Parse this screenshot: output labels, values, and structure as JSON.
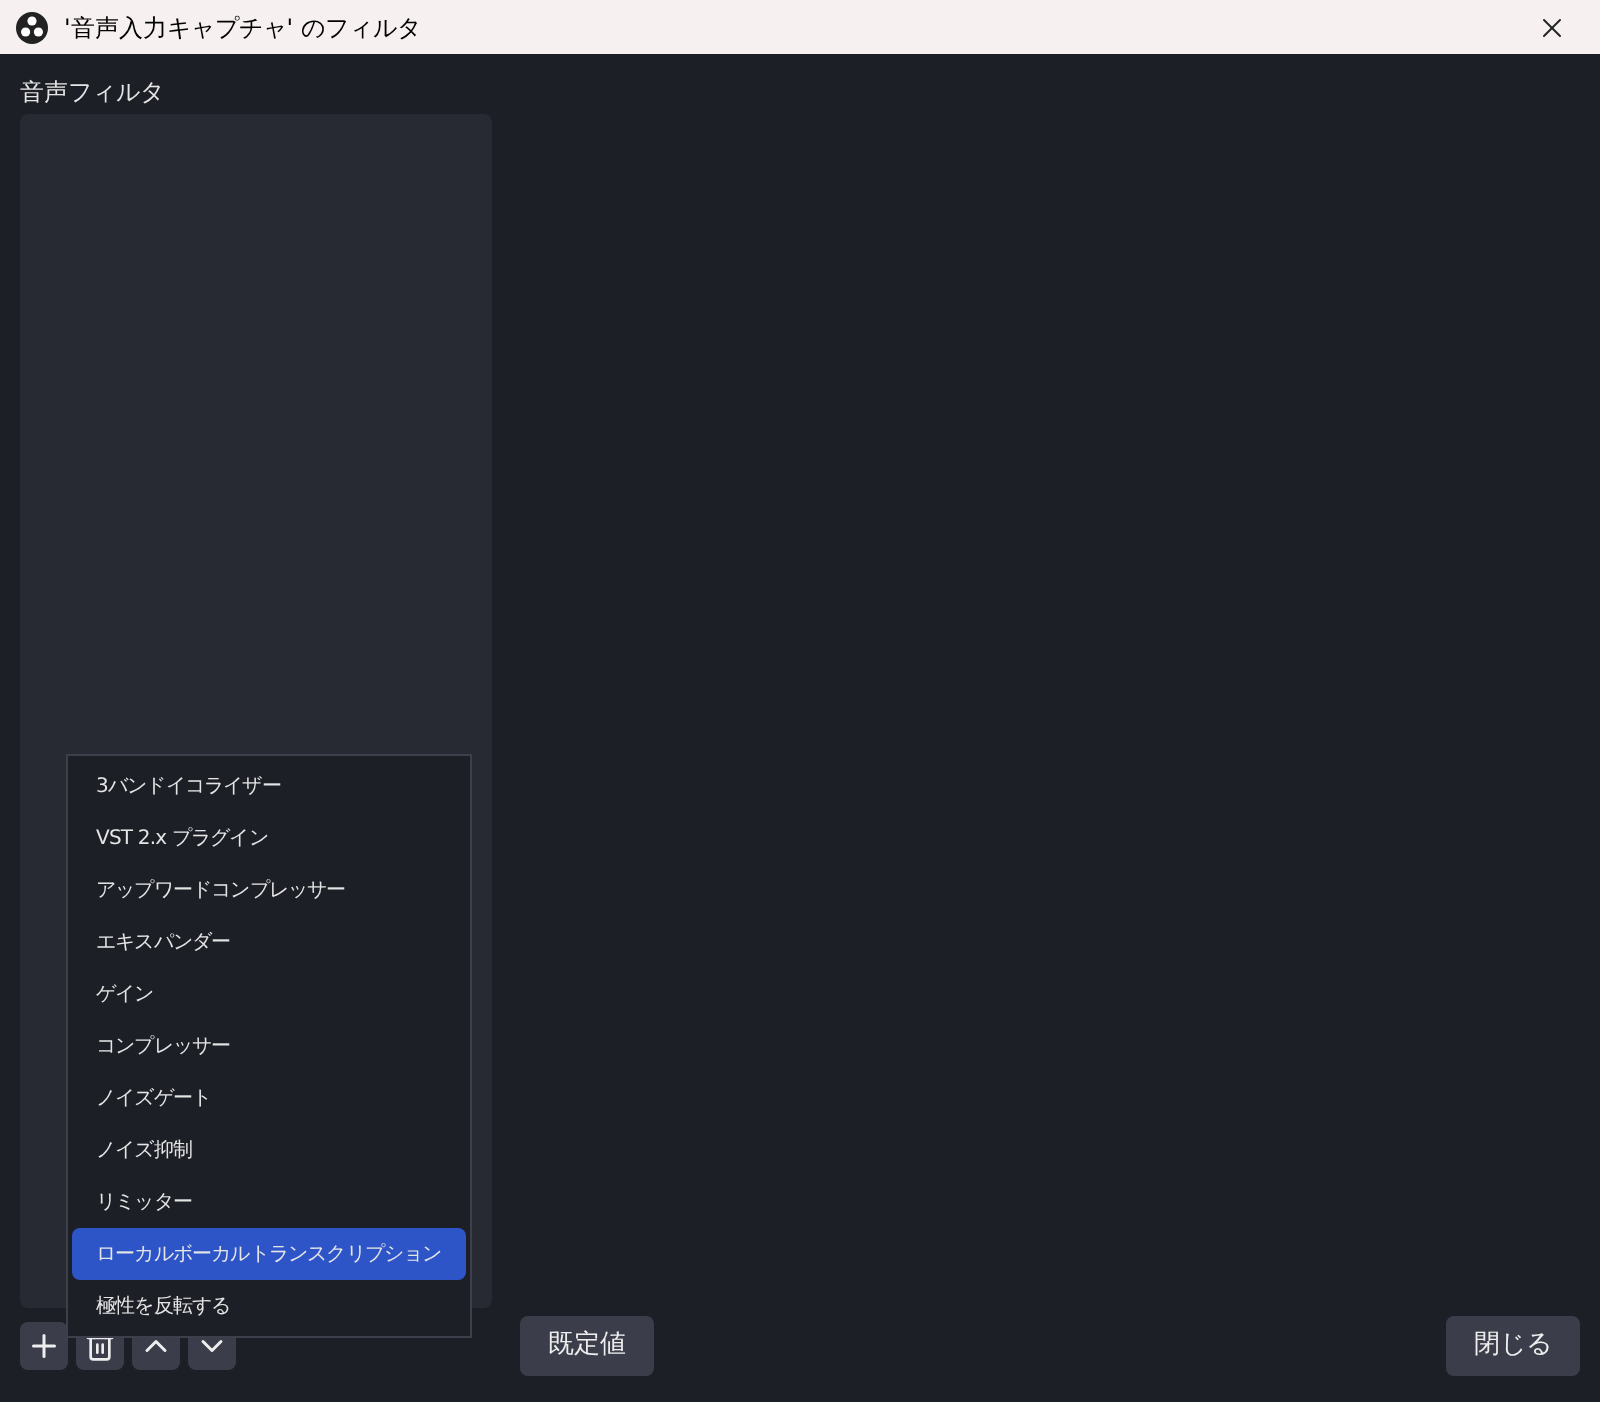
{
  "window": {
    "title": "'音声入力キャプチャ' のフィルタ"
  },
  "section_label": "音声フィルタ",
  "menu": [
    {
      "label": "3バンドイコライザー",
      "selected": false
    },
    {
      "label": "VST 2.x プラグイン",
      "selected": false
    },
    {
      "label": "アップワードコンプレッサー",
      "selected": false
    },
    {
      "label": "エキスパンダー",
      "selected": false
    },
    {
      "label": "ゲイン",
      "selected": false
    },
    {
      "label": "コンプレッサー",
      "selected": false
    },
    {
      "label": "ノイズゲート",
      "selected": false
    },
    {
      "label": "ノイズ抑制",
      "selected": false
    },
    {
      "label": "リミッター",
      "selected": false
    },
    {
      "label": "ローカルボーカルトランスクリプション",
      "selected": true
    },
    {
      "label": "極性を反転する",
      "selected": false
    }
  ],
  "buttons": [
    "既定値",
    "閉じる"
  ]
}
